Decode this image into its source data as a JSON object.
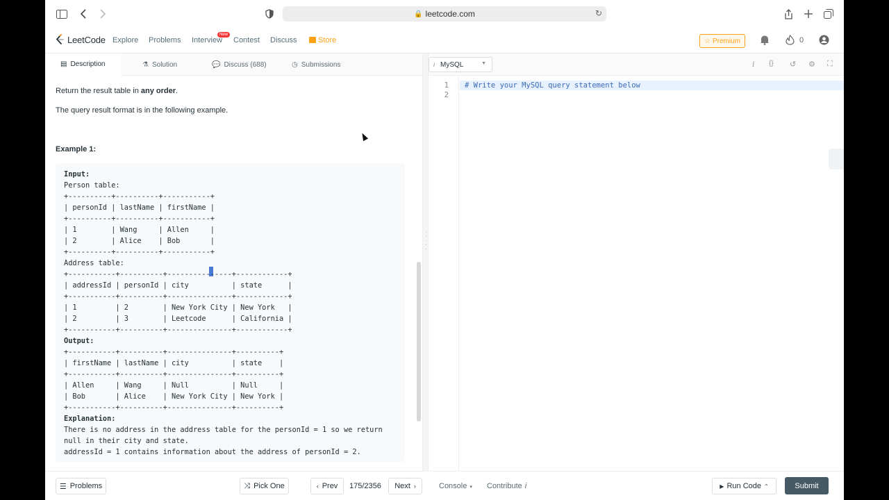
{
  "browser": {
    "url": "leetcode.com"
  },
  "nav": {
    "logo": "LeetCode",
    "links": [
      "Explore",
      "Problems",
      "Interview",
      "Contest",
      "Discuss",
      "Store"
    ],
    "new_badge": "New",
    "premium": "Premium",
    "coins": "0"
  },
  "tabs": {
    "description": "Description",
    "solution": "Solution",
    "discuss": "Discuss (688)",
    "submissions": "Submissions"
  },
  "description": {
    "return_prefix": "Return the result table in ",
    "return_bold": "any order",
    "return_suffix": ".",
    "format_text": "The query result format is in the following example.",
    "example_title": "Example 1:"
  },
  "example": {
    "lines": [
      "Input:",
      "Person table:",
      "+----------+----------+-----------+",
      "| personId | lastName | firstName |",
      "+----------+----------+-----------+",
      "| 1        | Wang     | Allen     |",
      "| 2        | Alice    | Bob       |",
      "+----------+----------+-----------+",
      "Address table:",
      "+-----------+----------+---------------+------------+",
      "| addressId | personId | city          | state      |",
      "+-----------+----------+---------------+------------+",
      "| 1         | 2        | New York City | New York   |",
      "| 2         | 3        | Leetcode      | California |",
      "+-----------+----------+---------------+------------+",
      "Output:",
      "+-----------+----------+---------------+----------+",
      "| firstName | lastName | city          | state    |",
      "+-----------+----------+---------------+----------+",
      "| Allen     | Wang     | Null          | Null     |",
      "| Bob       | Alice    | New York City | New York |",
      "+-----------+----------+---------------+----------+",
      "Explanation:",
      "There is no address in the address table for the personId = 1 so we return",
      "null in their city and state.",
      "addressId = 1 contains information about the address of personId = 2."
    ]
  },
  "editor": {
    "language": "MySQL",
    "line_numbers": [
      "1",
      "2"
    ],
    "code": "# Write your MySQL query statement below"
  },
  "footer": {
    "problems": "Problems",
    "pick_one": "Pick One",
    "prev": "Prev",
    "page": "175/2356",
    "next": "Next",
    "console": "Console",
    "contribute": "Contribute",
    "run_code": "Run Code",
    "submit": "Submit"
  }
}
